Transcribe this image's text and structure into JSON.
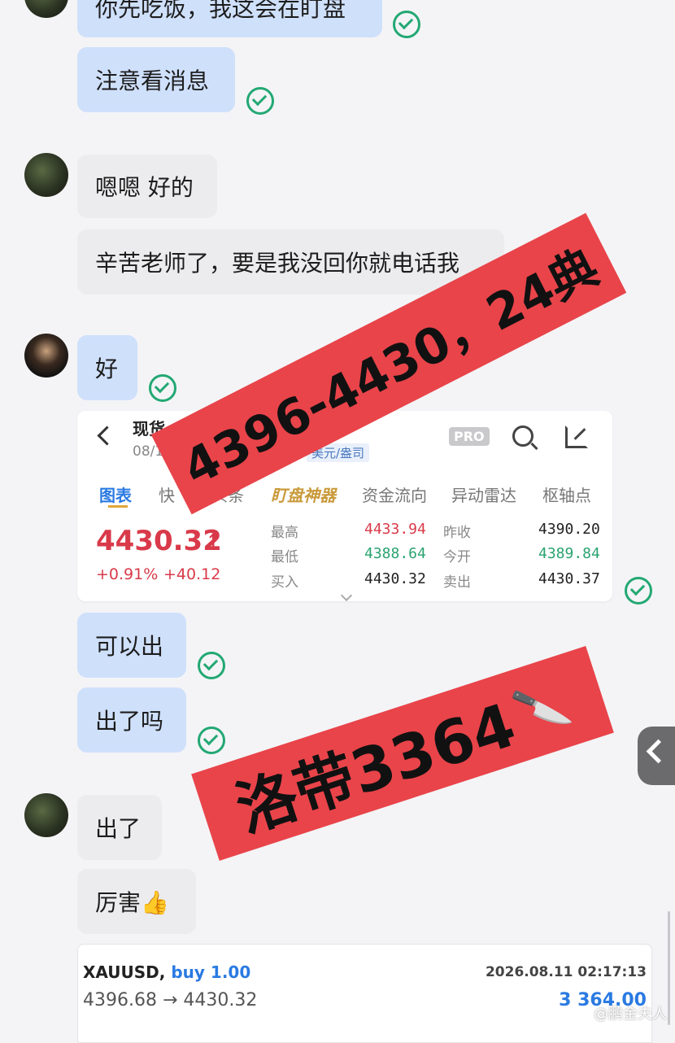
{
  "messages": {
    "m1": "你先吃饭，我这会在盯盘",
    "m2": "注意看消息",
    "m3": "嗯嗯 好的",
    "m4": "辛苦老师了，要是我没回你就电话我",
    "m5": "好",
    "m6": "可以出",
    "m7": "出了吗",
    "m8": "出了",
    "m9": "厉害👍"
  },
  "quote_card": {
    "title": "现货",
    "date": "08/1",
    "subtitle": "美元/盎司",
    "pro_badge": "PRO",
    "tabs": [
      "图表",
      "快",
      "头条",
      "盯盘神器",
      "资金流向",
      "异动雷达",
      "枢轴点"
    ],
    "price": "4430.32",
    "change_pct": "+0.91%",
    "change_abs": "+40.12",
    "stats": {
      "high_label": "最高",
      "high": "4433.94",
      "low_label": "最低",
      "low": "4388.64",
      "bid_label": "买入",
      "bid": "4430.32",
      "prev_close_label": "昨收",
      "prev_close": "4390.20",
      "open_label": "今开",
      "open": "4389.84",
      "ask_label": "卖出",
      "ask": "4430.37"
    }
  },
  "banners": {
    "top": "4396-4430，24典",
    "bottom": "洛带3364",
    "bottom_icon": "🔪"
  },
  "trade": {
    "symbol": "XAUUSD,",
    "side": "buy 1.00",
    "time": "2026.08.11 02:17:13",
    "prices": "4396.68 → 4430.32",
    "profit": "3 364.00"
  },
  "watermark": "@鹏金夫人",
  "colors": {
    "accent": "#2a7ae2",
    "up": "#d93a4a",
    "down": "#2aa370",
    "banner": "#e8444a",
    "check": "#23a874"
  }
}
